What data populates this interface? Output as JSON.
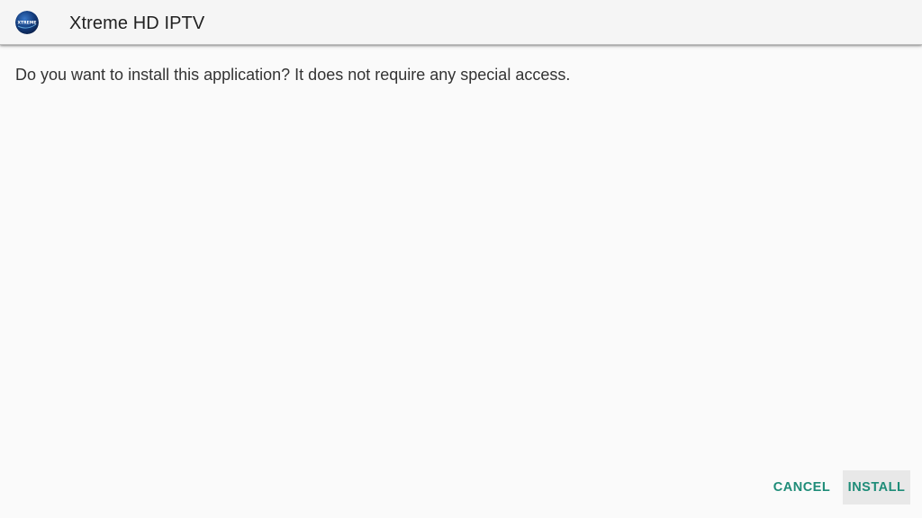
{
  "app_bar": {
    "title": "Xtreme HD IPTV",
    "icon": "xtreme-logo-icon",
    "icon_text": "XTREME"
  },
  "dialog": {
    "message": "Do you want to install this application? It does not require any special access."
  },
  "buttons": {
    "cancel_label": "CANCEL",
    "install_label": "INSTALL",
    "focused": "INSTALL"
  },
  "colors": {
    "accent": "#1e8c78",
    "background": "#fafafa",
    "app_bar": "#f5f5f5",
    "focused_button_bg": "#e8e8e8"
  }
}
